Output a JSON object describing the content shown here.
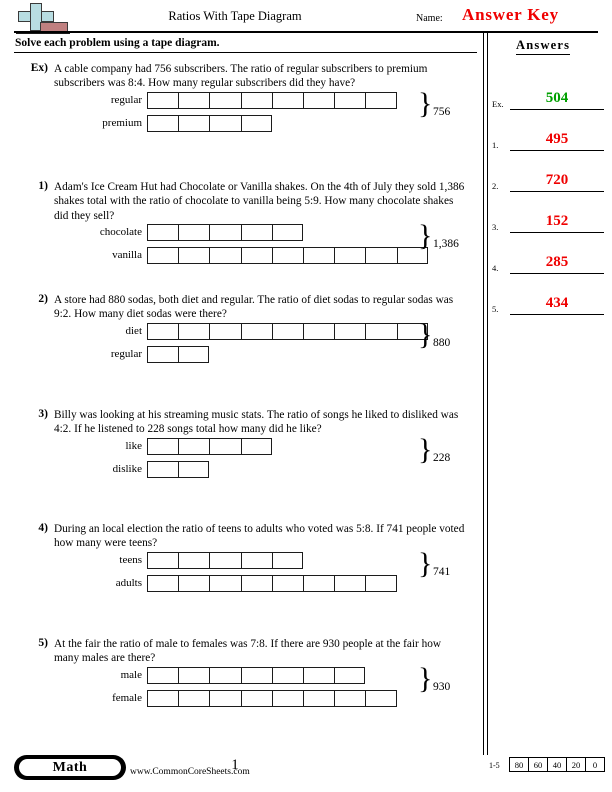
{
  "header": {
    "logo_icon": "plus-block-logo",
    "title": "Ratios With Tape Diagram",
    "name_label": "Name:",
    "answer_key": "Answer Key"
  },
  "instruction": "Solve each problem using a tape diagram.",
  "answers_panel": {
    "title": "Answers",
    "rows": [
      {
        "index": "Ex.",
        "value": "504",
        "color": "#00a000"
      },
      {
        "index": "1.",
        "value": "495",
        "color": "#ef0000"
      },
      {
        "index": "2.",
        "value": "720",
        "color": "#ef0000"
      },
      {
        "index": "3.",
        "value": "152",
        "color": "#ef0000"
      },
      {
        "index": "4.",
        "value": "285",
        "color": "#ef0000"
      },
      {
        "index": "5.",
        "value": "434",
        "color": "#ef0000"
      }
    ]
  },
  "problems": [
    {
      "number": "Ex)",
      "text": "A cable company had 756 subscribers. The ratio of regular subscribers to premium subscribers was 8:4. How many regular subscribers did they have?",
      "total": "756",
      "tapes": [
        {
          "label": "regular",
          "boxes": 8
        },
        {
          "label": "premium",
          "boxes": 4
        }
      ]
    },
    {
      "number": "1)",
      "text": "Adam's Ice Cream Hut had Chocolate or Vanilla shakes. On the 4th of July they sold 1,386 shakes total with the ratio of chocolate to vanilla being 5:9. How many chocolate shakes did they sell?",
      "total": "1,386",
      "tapes": [
        {
          "label": "chocolate",
          "boxes": 5
        },
        {
          "label": "vanilla",
          "boxes": 9
        }
      ]
    },
    {
      "number": "2)",
      "text": "A store had 880 sodas, both diet and regular. The ratio of diet sodas to regular sodas was 9:2. How many diet sodas were there?",
      "total": "880",
      "tapes": [
        {
          "label": "diet",
          "boxes": 9
        },
        {
          "label": "regular",
          "boxes": 2
        }
      ]
    },
    {
      "number": "3)",
      "text": "Billy was looking at his streaming music stats. The ratio of songs he liked to disliked was 4:2. If he listened to 228 songs total how many did he like?",
      "total": "228",
      "tapes": [
        {
          "label": "like",
          "boxes": 4
        },
        {
          "label": "dislike",
          "boxes": 2
        }
      ]
    },
    {
      "number": "4)",
      "text": "During an local election the ratio of teens to adults who voted was 5:8. If 741 people voted how many were teens?",
      "total": "741",
      "tapes": [
        {
          "label": "teens",
          "boxes": 5
        },
        {
          "label": "adults",
          "boxes": 8
        }
      ]
    },
    {
      "number": "5)",
      "text": "At the fair the ratio of male to females was 7:8. If there are 930 people at the fair how many males are there?",
      "total": "930",
      "tapes": [
        {
          "label": "male",
          "boxes": 7
        },
        {
          "label": "female",
          "boxes": 8
        }
      ]
    }
  ],
  "footer": {
    "subject": "Math",
    "website": "www.CommonCoreSheets.com",
    "page_number": "1",
    "score_range": "1-5",
    "score_values": [
      "80",
      "60",
      "40",
      "20",
      "0"
    ]
  }
}
